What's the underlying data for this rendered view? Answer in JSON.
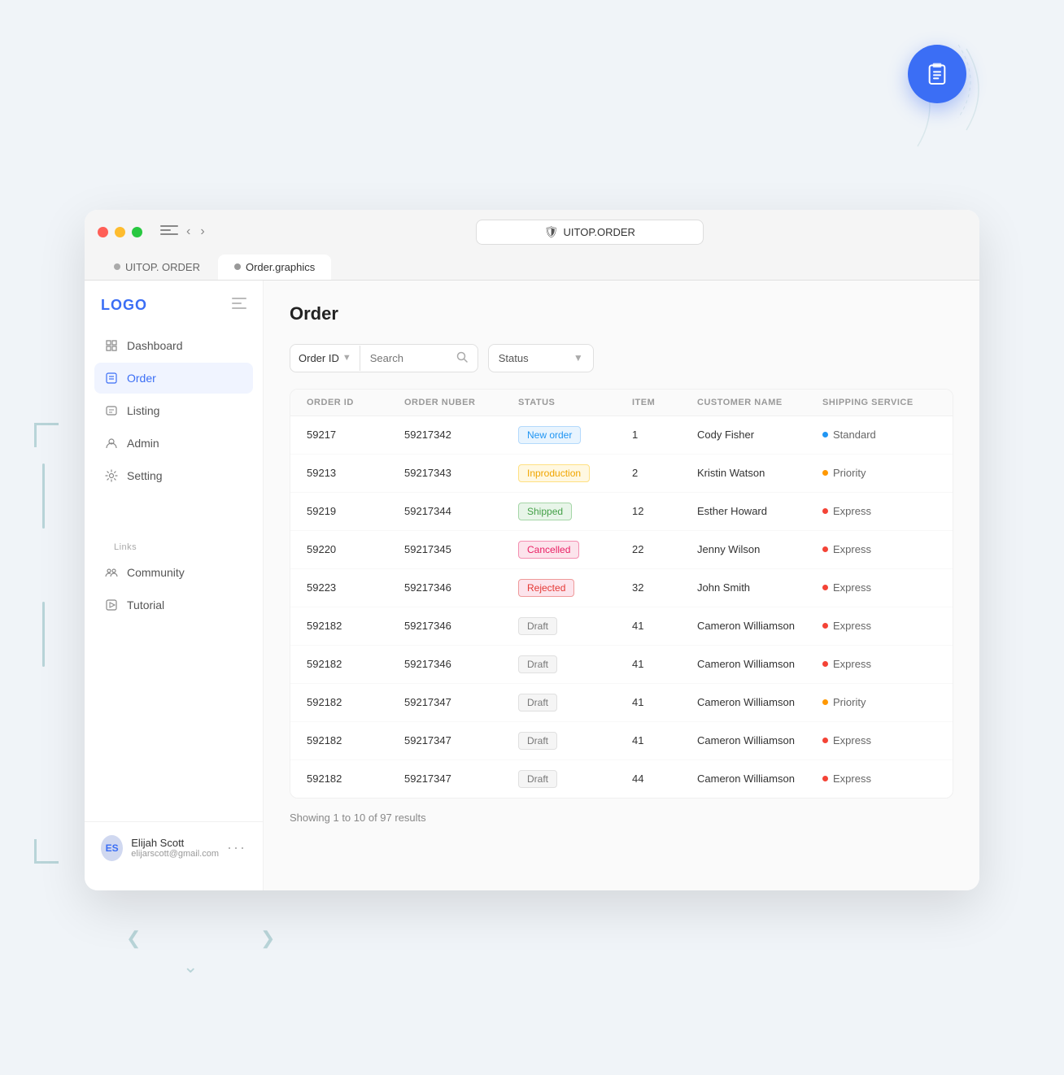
{
  "browser": {
    "address": "UITOP.ORDER",
    "tab1_label": "UITOP. ORDER",
    "tab2_label": "Order.graphics"
  },
  "sidebar": {
    "logo": "LOGO",
    "nav_items": [
      {
        "id": "dashboard",
        "label": "Dashboard",
        "active": false
      },
      {
        "id": "order",
        "label": "Order",
        "active": true
      },
      {
        "id": "listing",
        "label": "Listing",
        "active": false
      },
      {
        "id": "admin",
        "label": "Admin",
        "active": false
      },
      {
        "id": "setting",
        "label": "Setting",
        "active": false
      }
    ],
    "links_label": "Links",
    "links": [
      {
        "id": "community",
        "label": "Community"
      },
      {
        "id": "tutorial",
        "label": "Tutorial"
      }
    ],
    "user": {
      "name": "Elijah Scott",
      "email": "elijarscott@gmail.com",
      "initials": "ES"
    }
  },
  "page": {
    "title": "Order"
  },
  "filters": {
    "order_id_label": "Order ID",
    "search_placeholder": "Search",
    "status_label": "Status"
  },
  "table": {
    "headers": [
      "ORDER ID",
      "ORDER NUBER",
      "STATUS",
      "ITEM",
      "CUSTOMER NAME",
      "SHIPPING SERVICE"
    ],
    "rows": [
      {
        "order_id": "59217",
        "order_num": "59217342",
        "status": "New order",
        "status_type": "new",
        "item": "1",
        "customer": "Cody Fisher",
        "shipping": "Standard",
        "shipping_type": "standard"
      },
      {
        "order_id": "59213",
        "order_num": "59217343",
        "status": "Inproduction",
        "status_type": "inprod",
        "item": "2",
        "customer": "Kristin Watson",
        "shipping": "Priority",
        "shipping_type": "priority"
      },
      {
        "order_id": "59219",
        "order_num": "59217344",
        "status": "Shipped",
        "status_type": "shipped",
        "item": "12",
        "customer": "Esther Howard",
        "shipping": "Express",
        "shipping_type": "express"
      },
      {
        "order_id": "59220",
        "order_num": "59217345",
        "status": "Cancelled",
        "status_type": "cancelled",
        "item": "22",
        "customer": "Jenny Wilson",
        "shipping": "Express",
        "shipping_type": "express"
      },
      {
        "order_id": "59223",
        "order_num": "59217346",
        "status": "Rejected",
        "status_type": "rejected",
        "item": "32",
        "customer": "John Smith",
        "shipping": "Express",
        "shipping_type": "express"
      },
      {
        "order_id": "592182",
        "order_num": "59217346",
        "status": "Draft",
        "status_type": "draft",
        "item": "41",
        "customer": "Cameron Williamson",
        "shipping": "Express",
        "shipping_type": "express"
      },
      {
        "order_id": "592182",
        "order_num": "59217346",
        "status": "Draft",
        "status_type": "draft",
        "item": "41",
        "customer": "Cameron Williamson",
        "shipping": "Express",
        "shipping_type": "express"
      },
      {
        "order_id": "592182",
        "order_num": "59217347",
        "status": "Draft",
        "status_type": "draft",
        "item": "41",
        "customer": "Cameron Williamson",
        "shipping": "Priority",
        "shipping_type": "priority"
      },
      {
        "order_id": "592182",
        "order_num": "59217347",
        "status": "Draft",
        "status_type": "draft",
        "item": "41",
        "customer": "Cameron Williamson",
        "shipping": "Express",
        "shipping_type": "express"
      },
      {
        "order_id": "592182",
        "order_num": "59217347",
        "status": "Draft",
        "status_type": "draft",
        "item": "44",
        "customer": "Cameron Williamson",
        "shipping": "Express",
        "shipping_type": "express"
      }
    ],
    "results_text": "Showing 1 to 10 of 97 results"
  },
  "icons": {
    "clipboard": "📋",
    "dashboard": "⊙",
    "order": "▦",
    "listing": "▤",
    "admin": "◉",
    "setting": "◈",
    "community": "❋",
    "tutorial": "▷",
    "search": "🔍",
    "chevron_down": "▾",
    "more": "···",
    "shield": "🛡"
  }
}
